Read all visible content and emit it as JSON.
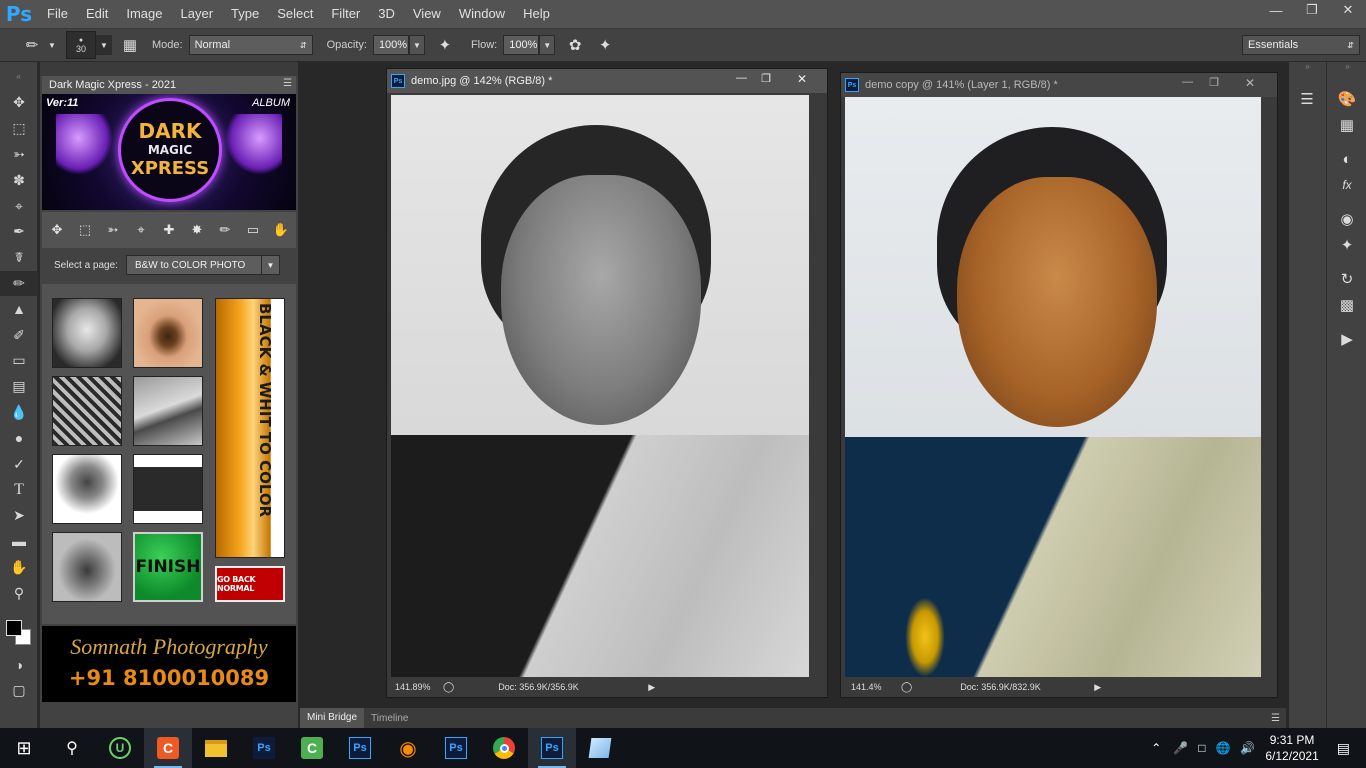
{
  "app": {
    "logo": "Ps",
    "menu": [
      "File",
      "Edit",
      "Image",
      "Layer",
      "Type",
      "Select",
      "Filter",
      "3D",
      "View",
      "Window",
      "Help"
    ]
  },
  "options": {
    "brush_size": "30",
    "mode_label": "Mode:",
    "mode_value": "Normal",
    "opacity_label": "Opacity:",
    "opacity_value": "100%",
    "flow_label": "Flow:",
    "flow_value": "100%",
    "workspace": "Essentials"
  },
  "extension": {
    "panel_title": "Dark Magic Xpress - 2021",
    "banner_version": "Ver:11",
    "banner_album": "ALBUM",
    "banner_line1": "DARK",
    "banner_line2": "MAGIC",
    "banner_line3": "XPRESS",
    "select_label": "Select a page:",
    "select_value": "B&W to COLOR PHOTO",
    "vertical_banner": "BLACK & WHIT TO COLOR",
    "finish_label": "FINISH",
    "go_back_label": "GO BACK NORMAL",
    "credit_name": "Somnath Photography",
    "credit_phone": "+91 8100010089"
  },
  "documents": [
    {
      "title": "demo.jpg @ 142% (RGB/8) *",
      "zoom": "141.89%",
      "doc_size": "Doc: 356.9K/356.9K"
    },
    {
      "title": "demo copy @ 141% (Layer 1, RGB/8) *",
      "zoom": "141.4%",
      "doc_size": "Doc: 356.9K/832.9K"
    }
  ],
  "bottom_tabs": [
    "Mini Bridge",
    "Timeline"
  ],
  "taskbar": {
    "time": "9:31 PM",
    "date": "6/12/2021"
  },
  "colors": {
    "ps_blue": "#31a8ff",
    "panel": "#424242",
    "canvas": "#282828"
  }
}
